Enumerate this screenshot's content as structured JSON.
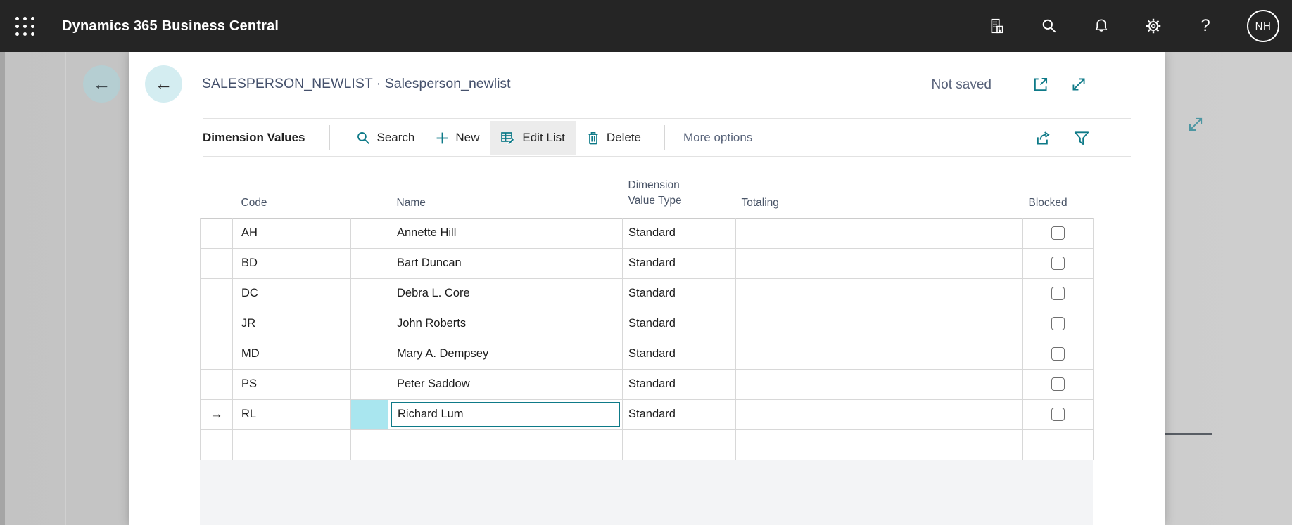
{
  "topbar": {
    "app_title": "Dynamics 365 Business Central",
    "avatar_initials": "NH"
  },
  "dialog": {
    "title": "SALESPERSON_NEWLIST · Salesperson_newlist",
    "save_status": "Not saved",
    "caption": "Dimension Values",
    "actions": {
      "search": "Search",
      "new": "New",
      "edit_list": "Edit List",
      "delete": "Delete",
      "more_options": "More options"
    }
  },
  "table": {
    "columns": {
      "code": "Code",
      "name": "Name",
      "dimension_value_type": "Dimension Value Type",
      "totaling": "Totaling",
      "blocked": "Blocked"
    },
    "rows": [
      {
        "code": "AH",
        "name": "Annette Hill",
        "dimension_value_type": "Standard",
        "totaling": "",
        "blocked": false
      },
      {
        "code": "BD",
        "name": "Bart Duncan",
        "dimension_value_type": "Standard",
        "totaling": "",
        "blocked": false
      },
      {
        "code": "DC",
        "name": "Debra L. Core",
        "dimension_value_type": "Standard",
        "totaling": "",
        "blocked": false
      },
      {
        "code": "JR",
        "name": "John Roberts",
        "dimension_value_type": "Standard",
        "totaling": "",
        "blocked": false
      },
      {
        "code": "MD",
        "name": "Mary A. Dempsey",
        "dimension_value_type": "Standard",
        "totaling": "",
        "blocked": false
      },
      {
        "code": "PS",
        "name": "Peter Saddow",
        "dimension_value_type": "Standard",
        "totaling": "",
        "blocked": false
      },
      {
        "code": "RL",
        "name": "Richard Lum",
        "dimension_value_type": "Standard",
        "totaling": "",
        "blocked": false,
        "selected": true,
        "editing": true
      }
    ],
    "has_trailing_empty_row": true
  },
  "colors": {
    "accent_teal": "#0e7a88",
    "selected_cell_cyan": "#a9e6ef",
    "topbar_bg": "#252525",
    "title_text": "#45516c",
    "status_text": "#58627a",
    "footer_bg": "#f3f4f6"
  }
}
